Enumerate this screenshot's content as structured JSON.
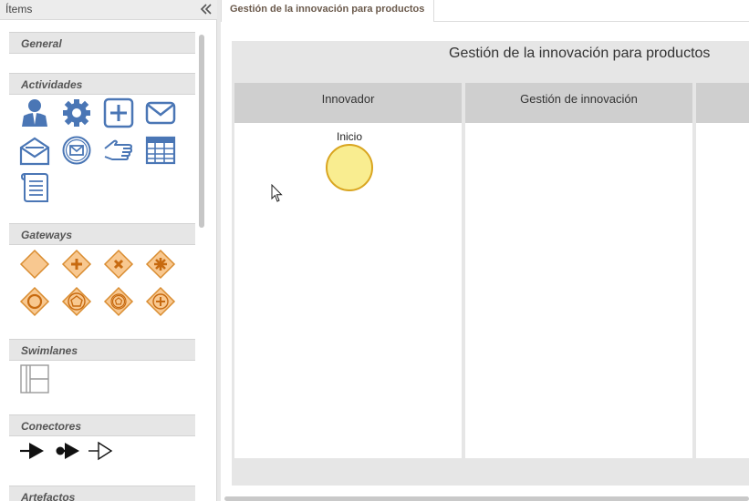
{
  "panel": {
    "title": "Ítems",
    "sections": {
      "general": "General",
      "actividades": "Actividades",
      "gateways": "Gateways",
      "swimlanes": "Swimlanes",
      "conectores": "Conectores",
      "artefactos": "Artefactos"
    }
  },
  "tab": {
    "label": "Gestión de la innovación para productos"
  },
  "diagram": {
    "pool_title": "Gestión de la innovación para productos",
    "lanes": [
      "Innovador",
      "Gestión de innovación",
      ""
    ],
    "start_event_label": "Inicio"
  },
  "colors": {
    "icon_blue": "#4a76b5",
    "gateway_fill": "#f8c890",
    "gateway_stroke": "#d98c30",
    "gateway_mark": "#c76a10",
    "start_fill": "#f9ed90",
    "start_stroke": "#d9a520"
  },
  "icons": [
    "user-task-icon",
    "service-task-icon",
    "subprocess-icon",
    "send-task-icon",
    "receive-task-icon",
    "message-task-icon",
    "manual-task-icon",
    "business-rule-icon",
    "script-task-icon",
    "exclusive-gateway-icon",
    "parallel-gateway-icon",
    "xor-gateway-icon",
    "complex-gateway-icon",
    "event-gateway-icon",
    "event-based-gateway-icon",
    "exclusive-event-gateway-icon",
    "parallel-event-gateway-icon",
    "swimlane-icon",
    "sequence-flow-icon",
    "message-flow-icon",
    "association-icon"
  ]
}
